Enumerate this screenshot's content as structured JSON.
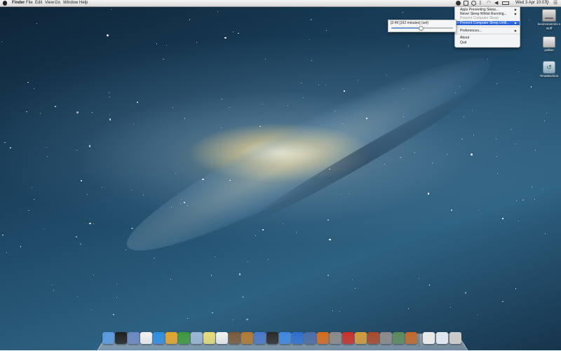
{
  "menubar": {
    "app_name": "Finder",
    "menus": [
      "File",
      "Edit",
      "View",
      "Go",
      "Window",
      "Help"
    ],
    "clock": "Wed 3 Apr  10:07"
  },
  "app_menu": {
    "items": [
      {
        "label": "Apps Preventing Sleep...",
        "submenu": true,
        "state": "normal"
      },
      {
        "label": "Never Sleep Whilst Running...",
        "submenu": true,
        "state": "normal"
      },
      {
        "label": "Prevent Computer Sleep",
        "submenu": false,
        "state": "disabled"
      },
      {
        "label": "Prevent Computer Sleep Until...",
        "submenu": true,
        "state": "selected",
        "checked": true
      },
      {
        "label": "Preferences...",
        "submenu": true,
        "state": "normal"
      },
      {
        "label": "About",
        "submenu": false,
        "state": "normal"
      },
      {
        "label": "Quit",
        "submenu": false,
        "state": "normal"
      }
    ]
  },
  "submenu": {
    "timer_text": "[2:49 [162 minutes] (set)",
    "slider_value": 0.48
  },
  "desktop_icons": [
    {
      "label": "kevinsmemnis s stuff",
      "icon": "hard-drive-icon"
    },
    {
      "label": "polkas",
      "icon": "external-drive-icon"
    },
    {
      "label": "TimeMachine",
      "icon": "time-machine-icon"
    }
  ],
  "dock": {
    "apps": [
      {
        "name": "finder",
        "color": "#5a9be0"
      },
      {
        "name": "terminal",
        "color": "#1f1f1f"
      },
      {
        "name": "preview",
        "color": "#6a88c2"
      },
      {
        "name": "calendar",
        "color": "#f2f2f2"
      },
      {
        "name": "safari",
        "color": "#2f8de0"
      },
      {
        "name": "chrome",
        "color": "#e2a52a"
      },
      {
        "name": "utility",
        "color": "#3a9a3a"
      },
      {
        "name": "mail",
        "color": "#9bb5d4"
      },
      {
        "name": "notes",
        "color": "#e8dc7a"
      },
      {
        "name": "textedit",
        "color": "#f1f1f1"
      },
      {
        "name": "photos",
        "color": "#7a5a3a"
      },
      {
        "name": "instruments",
        "color": "#b07a30"
      },
      {
        "name": "xcode",
        "color": "#4a78c8"
      },
      {
        "name": "console",
        "color": "#2a2a2a"
      },
      {
        "name": "app-store",
        "color": "#3e87e0"
      },
      {
        "name": "network",
        "color": "#2f6fd0"
      },
      {
        "name": "system",
        "color": "#4a6ca8"
      },
      {
        "name": "firefox",
        "color": "#d46b1f"
      },
      {
        "name": "utility-2",
        "color": "#8a8a8a"
      },
      {
        "name": "red-app",
        "color": "#c8302a"
      },
      {
        "name": "scripts",
        "color": "#d29a3a"
      },
      {
        "name": "photo-app",
        "color": "#a84a2a"
      },
      {
        "name": "preferences",
        "color": "#8a8a8a"
      },
      {
        "name": "activity-monitor",
        "color": "#5a8a5a"
      },
      {
        "name": "games",
        "color": "#c06a2a"
      }
    ],
    "stacks": [
      {
        "name": "documents-stack",
        "color": "#e8e8e8"
      },
      {
        "name": "downloads-stack",
        "color": "#dfe6ee"
      },
      {
        "name": "trash",
        "color": "#c9c9c9"
      }
    ]
  }
}
